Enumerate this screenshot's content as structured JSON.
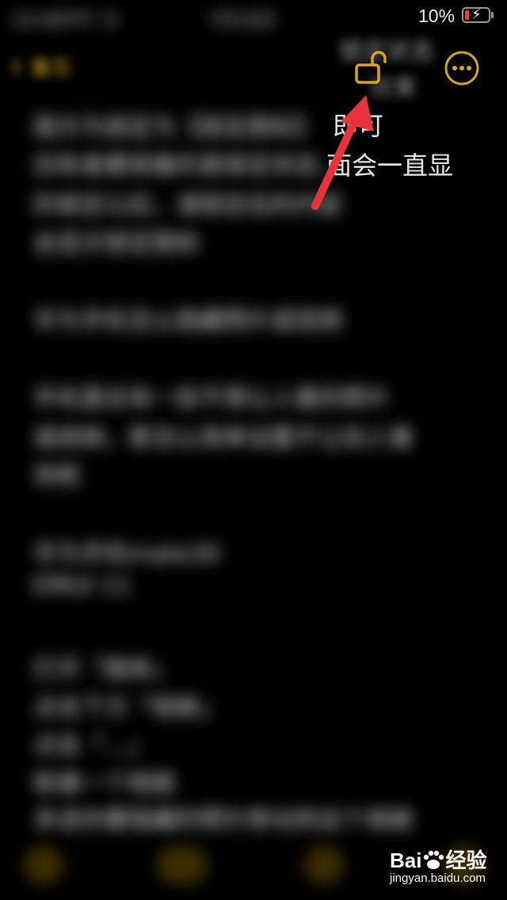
{
  "status_bar": {
    "left_text": "10:08中午 令",
    "center_text": "7月18日",
    "battery_percent": "10%",
    "battery_level": 0.1,
    "battery_charging": true
  },
  "nav": {
    "back_label": "备忘",
    "back_icon": "chevron-left-icon",
    "lock_icon": "unlock-icon",
    "more_icon": "ellipsis-circle-icon"
  },
  "overlay_visible": {
    "line_a": "锁定状态",
    "line_b": "效果",
    "line_c": "即可",
    "line_d": "面会一直显"
  },
  "note": {
    "lines": [
      "提示为锁定为【锁定图标】",
      "旧有者要锁着的是锁定状态，",
      "的锁定以后，请锁定后的内容",
      "会显示锁定图标",
      "",
      "华为手机怎么隐藏照片或视频",
      "",
      "手机里总有一些不想让人看的照片",
      "或视频，那怎么简单设置不让别人看",
      "到呢",
      "",
      "华为手机mate30",
      "EMUI 11",
      "",
      "打开「图库」",
      "点击下方「相册」",
      "点击「...」",
      "新建一个相册",
      "多选你要隐藏的照片移动到这个相册"
    ]
  },
  "toolbar": {
    "items": [
      "checklist-icon",
      "camera-icon",
      "pen-icon",
      "compose-icon"
    ]
  },
  "watermark": {
    "brand_left": "Bai",
    "brand_right": "经验",
    "url": "jingyan.baidu.com"
  },
  "colors": {
    "accent": "#d9a520",
    "arrow": "#e8323c",
    "background": "#000000"
  }
}
